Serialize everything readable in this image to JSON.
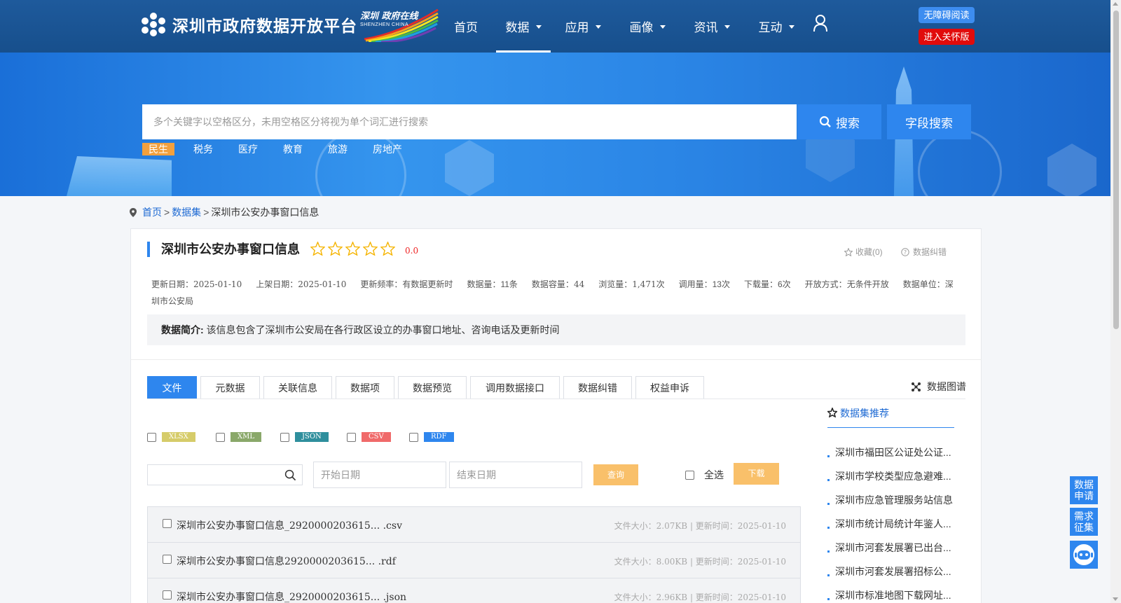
{
  "header": {
    "logo_title": "深圳市政府数据开放平台",
    "badge_title": "深圳 政府在线",
    "badge_sub": "SHENZHEN CHINA",
    "nav": [
      {
        "label": "首页",
        "caret": false
      },
      {
        "label": "数据",
        "caret": true
      },
      {
        "label": "应用",
        "caret": true
      },
      {
        "label": "画像",
        "caret": true
      },
      {
        "label": "资讯",
        "caret": true
      },
      {
        "label": "互动",
        "caret": true
      }
    ],
    "access_btn": "无障碍阅读",
    "care_btn": "进入关怀版"
  },
  "search": {
    "placeholder": "多个关键字以空格区分，未用空格区分将视为单个词汇进行搜索",
    "search_btn": "搜索",
    "field_btn": "字段搜索",
    "hot_tags": [
      "民生",
      "税务",
      "医疗",
      "教育",
      "旅游",
      "房地产"
    ]
  },
  "breadcrumb": {
    "home": "首页",
    "dataset": "数据集",
    "current": "深圳市公安办事窗口信息",
    "sep": ">"
  },
  "dataset": {
    "title": "深圳市公安办事窗口信息",
    "score": "0.0",
    "stars": 0,
    "favorite": "收藏(0)",
    "correction": "数据纠错",
    "meta": [
      {
        "label": "更新日期：",
        "value": "2025-01-10"
      },
      {
        "label": "上架日期：",
        "value": "2025-01-10"
      },
      {
        "label": "更新频率：",
        "value": "有数据更新时"
      },
      {
        "label": "数据量：",
        "value": "11条"
      },
      {
        "label": "数据容量：",
        "value": "44"
      },
      {
        "label": "浏览量：",
        "value": "1,471次"
      },
      {
        "label": "调用量：",
        "value": "13次"
      },
      {
        "label": "下载量：",
        "value": "6次"
      },
      {
        "label": "开放方式：",
        "value": "无条件开放"
      },
      {
        "label": "数据单位：",
        "value": "深圳市公安局"
      }
    ],
    "intro_label": "数据简介:",
    "intro_text": "该信息包含了深圳市公安局在各行政区设立的办事窗口地址、咨询电话及更新时间"
  },
  "tabs": [
    "文件",
    "元数据",
    "关联信息",
    "数据项",
    "数据预览",
    "调用数据接口",
    "数据纠错",
    "权益申诉"
  ],
  "graph_link": "数据图谱",
  "formats": [
    {
      "label": "XLSX",
      "color": "#d6cc6a"
    },
    {
      "label": "XML",
      "color": "#8aa86a"
    },
    {
      "label": "JSON",
      "color": "#2f8f9d"
    },
    {
      "label": "CSV",
      "color": "#f06a6a"
    },
    {
      "label": "RDF",
      "color": "#2e86ee"
    }
  ],
  "query": {
    "start_placeholder": "开始日期",
    "end_placeholder": "结束日期",
    "query_btn": "查询",
    "select_all": "全选",
    "download_btn": "下载"
  },
  "files": [
    {
      "name": "深圳市公安办事窗口信息_2920000203615... .csv",
      "info": "文件大小：2.07KB | 更新时间：2025-01-10"
    },
    {
      "name": "深圳市公安办事窗口信息2920000203615... .rdf",
      "info": "文件大小：8.00KB | 更新时间：2025-01-10"
    },
    {
      "name": "深圳市公安办事窗口信息_2920000203615... .json",
      "info": "文件大小：2.96KB | 更新时间：2025-01-10"
    }
  ],
  "recommend": {
    "title": "数据集推荐",
    "items": [
      "深圳市福田区公证处公证...",
      "深圳市学校类型应急避难...",
      "深圳市应急管理服务站信息",
      "深圳市统计局统计年鉴人...",
      "深圳市河套发展署已出台...",
      "深圳市河套发展署招标公...",
      "深圳市标准地图下载网址..."
    ]
  },
  "floating": {
    "apply": "数据申请",
    "demand": "需求征集"
  },
  "colors": {
    "primary": "#2e86ee",
    "header": "#1e5a9c",
    "accent": "#f9c06a",
    "care": "#e10b0b"
  }
}
